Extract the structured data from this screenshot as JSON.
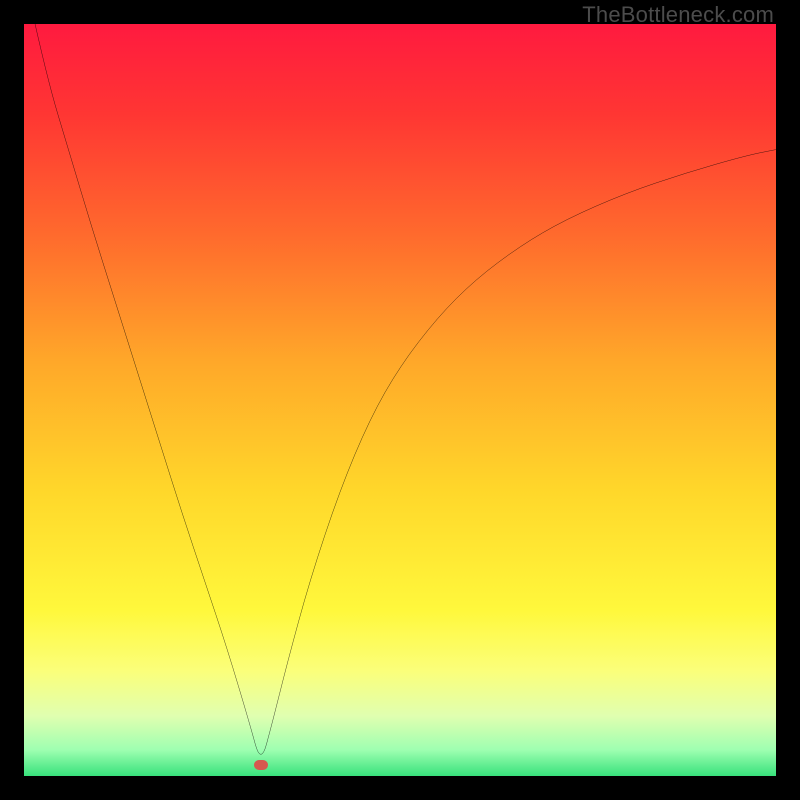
{
  "watermark": {
    "text": "TheBottleneck.com"
  },
  "chart_data": {
    "type": "line",
    "title": "",
    "xlabel": "",
    "ylabel": "",
    "xlim": [
      0,
      100
    ],
    "ylim": [
      0,
      100
    ],
    "grid": false,
    "legend": false,
    "marker": {
      "x": 31.5,
      "y": 1.5,
      "color": "#d65a4f"
    },
    "gradient_stops": [
      {
        "pos": 0.0,
        "color": "#ff1a3f"
      },
      {
        "pos": 0.12,
        "color": "#ff3633"
      },
      {
        "pos": 0.28,
        "color": "#ff6a2d"
      },
      {
        "pos": 0.45,
        "color": "#ffa829"
      },
      {
        "pos": 0.62,
        "color": "#ffd72a"
      },
      {
        "pos": 0.78,
        "color": "#fff83c"
      },
      {
        "pos": 0.86,
        "color": "#fbff7a"
      },
      {
        "pos": 0.92,
        "color": "#e0ffb0"
      },
      {
        "pos": 0.965,
        "color": "#9fffb1"
      },
      {
        "pos": 1.0,
        "color": "#38e27c"
      }
    ],
    "series": [
      {
        "name": "bottleneck-curve",
        "x": [
          0.8,
          3,
          6,
          9,
          12,
          15,
          18,
          21,
          24,
          27,
          30,
          31.5,
          33,
          35,
          38,
          42,
          46,
          50,
          55,
          60,
          66,
          72,
          80,
          88,
          96,
          100
        ],
        "y": [
          103,
          93,
          83,
          73,
          63.5,
          54,
          44.5,
          35,
          26,
          17,
          7,
          1.5,
          7,
          15,
          26,
          38,
          47.5,
          54.5,
          61,
          66,
          70.5,
          74,
          77.5,
          80.2,
          82.5,
          83.3
        ]
      }
    ]
  }
}
